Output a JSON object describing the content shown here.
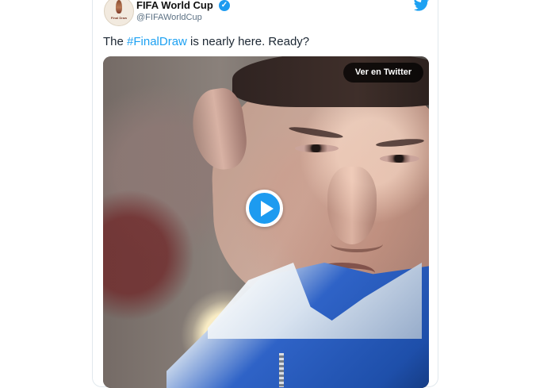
{
  "tweet": {
    "account": {
      "display_name": "FIFA World Cup",
      "handle": "@FIFAWorldCup",
      "verified_icon": "✓",
      "avatar_text": "Final Draw",
      "avatar_icon": "trophy-icon"
    },
    "text": {
      "prefix": "The ",
      "hashtag": "#FinalDraw",
      "suffix": " is nearly here. Ready?"
    },
    "media": {
      "ver_label": "Ver en Twitter",
      "play_icon": "play-icon"
    },
    "brand_icon": "twitter-bird-icon"
  },
  "colors": {
    "twitter_blue": "#1da1f2",
    "verified_blue": "#1d9bf0"
  }
}
